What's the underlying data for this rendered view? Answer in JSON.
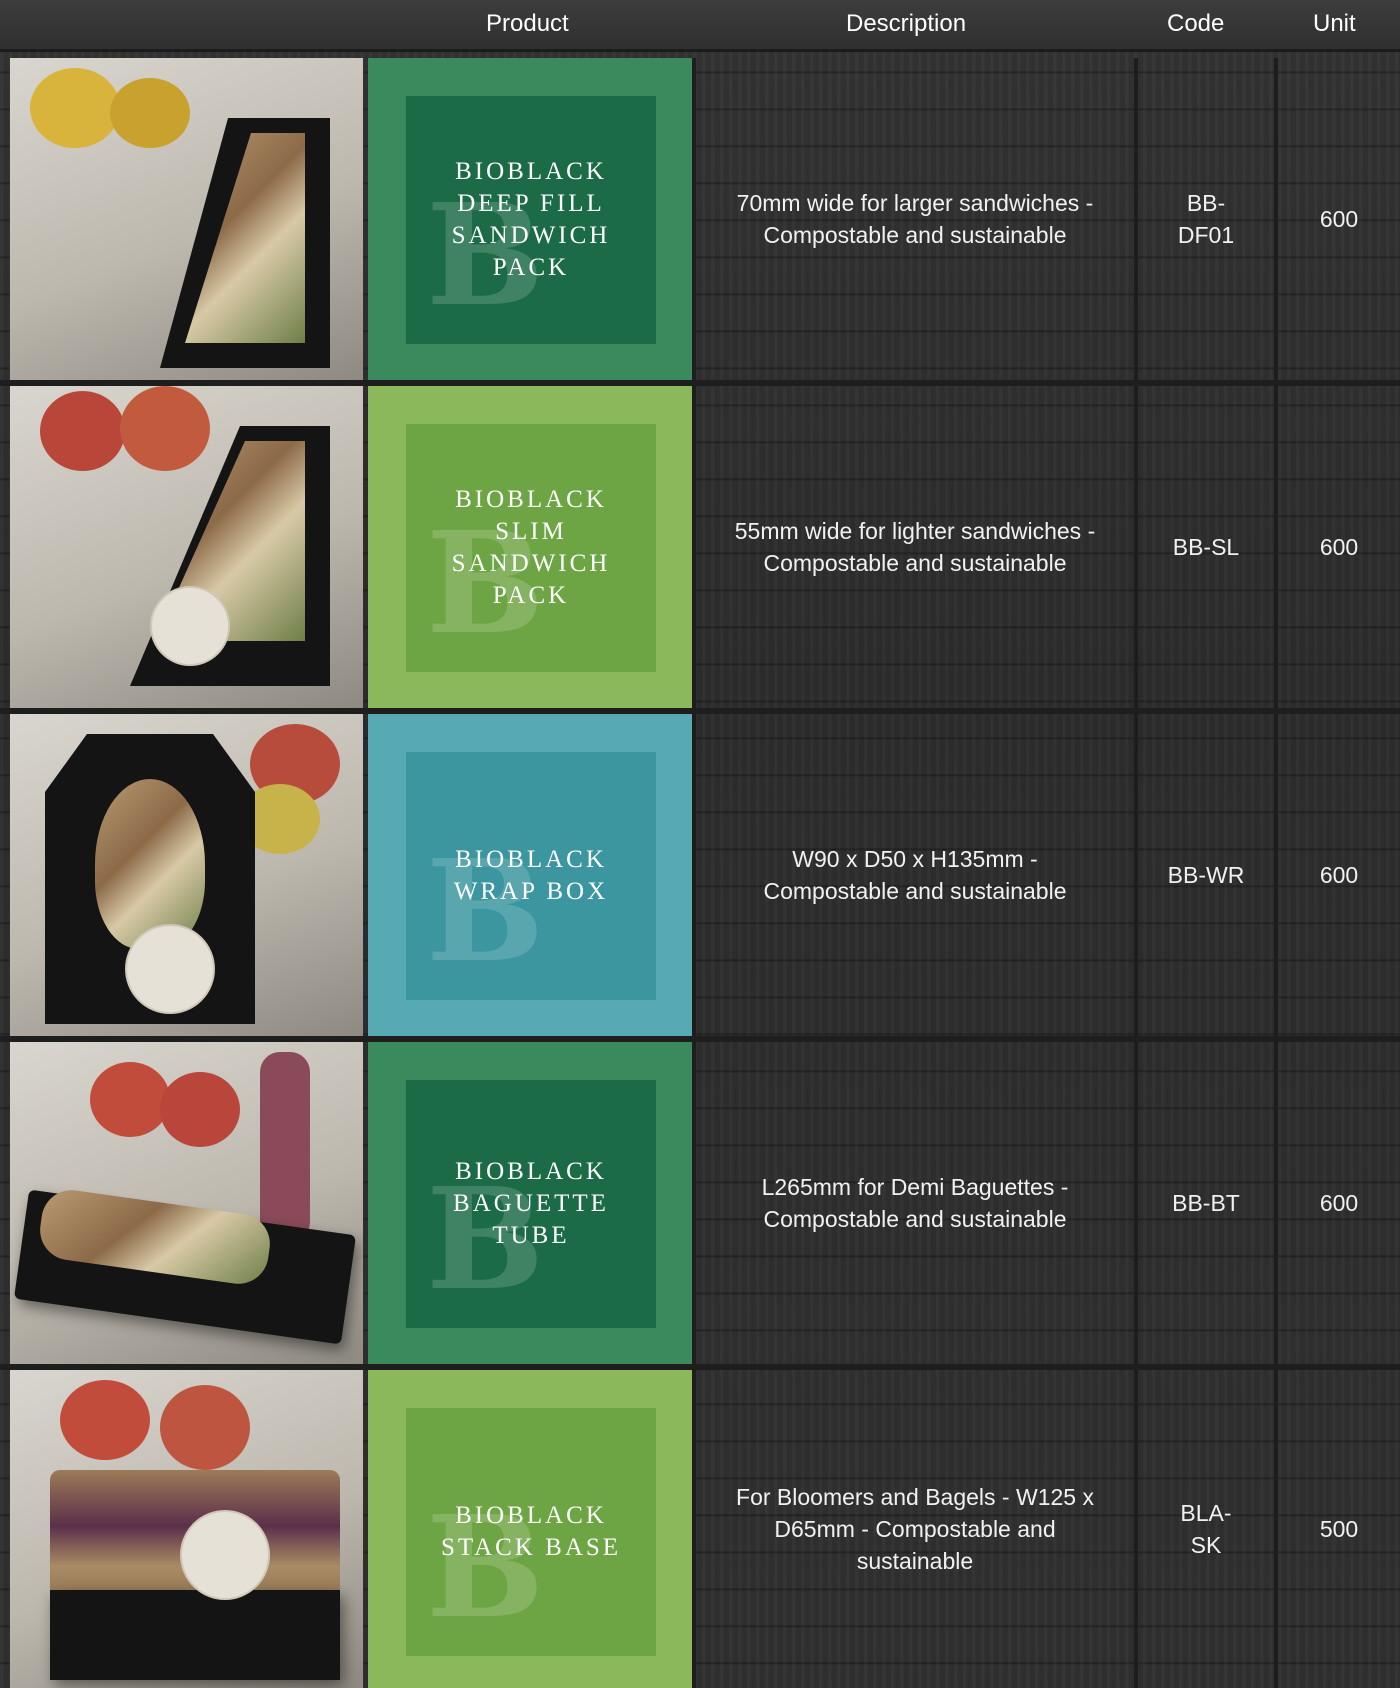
{
  "header": {
    "product": "Product",
    "description": "Description",
    "code": "Code",
    "unit": "Unit"
  },
  "colors": {
    "dark_green": "#1b6b47",
    "light_green": "#6ea544",
    "teal": "#3b969f",
    "wood": "#2c2c2c"
  },
  "rows": [
    {
      "title": "BIOBLACK DEEP FILL SANDWICH PACK",
      "description": "70mm wide for larger sandwiches - Compostable and sustainable",
      "code": "BB-DF01",
      "unit": "600"
    },
    {
      "title": "BIOBLACK SLIM SANDWICH PACK",
      "description": "55mm wide for lighter sandwiches - Compostable and sustainable",
      "code": "BB-SL",
      "unit": "600"
    },
    {
      "title": "BIOBLACK WRAP BOX",
      "description": "W90 x D50 x H135mm - Compostable and sustainable",
      "code": "BB-WR",
      "unit": "600"
    },
    {
      "title": "BIOBLACK BAGUETTE TUBE",
      "description": "L265mm for Demi Baguettes - Compostable and sustainable",
      "code": "BB-BT",
      "unit": "600"
    },
    {
      "title": "BIOBLACK STACK BASE",
      "description": "For Bloomers and Bagels - W125 x D65mm - Compostable and sustainable",
      "code": "BLA-SK",
      "unit": "500"
    }
  ]
}
